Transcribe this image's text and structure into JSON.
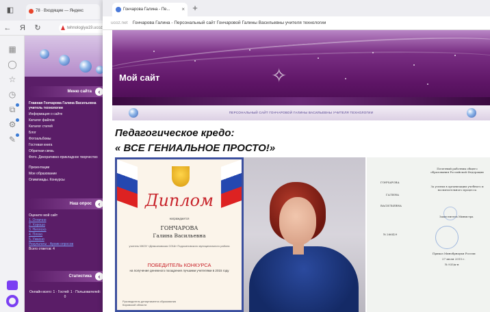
{
  "back_browser": {
    "tab1_label": "78 · Входящие — Яндекс",
    "url_text": "tehnologiya19.ucoz"
  },
  "front_browser": {
    "tab_label": "Гончарова Галина - Пе...",
    "address_prefix": "ucoz.net",
    "address_title": "Гончарова Галина - Персональный сайт Гончаровой Галины Васильевны учителя технологии"
  },
  "site": {
    "title": "Мой сайт",
    "subtitle": "ПЕРСОНАЛЬНЫЙ САЙТ ГОНЧАРОВОЙ ГАЛИНЫ ВАСИЛЬЕВНЫ УЧИТЕЛЯ ТЕХНОЛОГИИ",
    "creed_heading": "Педагогическое кредо:",
    "creed_text": "« ВСЕ ГЕНИАЛЬНОЕ ПРОСТО!»"
  },
  "menu": {
    "header": "Меню сайта",
    "items": [
      "Главная Гончарова Галина Васильевна учитель технологии",
      "Информация о сайте",
      "Каталог файлов",
      "Каталог статей",
      "Блог",
      "Фотоальбомы",
      "Гостевая книга",
      "Обратная связь",
      "Фото. Декоративно-прикладное творчество",
      "Презентации",
      "Мое образование",
      "Олимпиады. Конкурсы"
    ]
  },
  "login": {
    "header": "Наш опрос",
    "question": "Оцените мой сайт",
    "options": [
      "1. Отлично",
      "2. Хорошо",
      "3. Неплохо",
      "4. Плохо",
      "5. Ужасно"
    ],
    "links": "Результаты · Архив опросов",
    "total": "Всего ответов: 4"
  },
  "stats": {
    "header": "Статистика",
    "text": "Онлайн всего: 1 · Гостей: 1 · Пользователей: 0"
  },
  "diploma": {
    "word": "Диплом",
    "award_text": "награждается",
    "name_surname": "ГОНЧАРОВА",
    "name_given": "Галина Васильевна",
    "school": "учитель МКОУ «Демьяновская СОШ» Подосиновского муниципального района",
    "winner": "ПОБЕДИТЕЛЬ КОНКУРСА",
    "winner_sub": "на получение денежного поощрения лучшими учителями в 2015 году",
    "bottom": "Руководитель департамента образования Кировской области"
  },
  "certificate": {
    "lines": [
      "ГОНЧАРОВА",
      "ГАЛИНА",
      "ВАСИЛЬЕВНА",
      "№ 266429"
    ],
    "right_lines": [
      "Почетный работник общего образования Российской Федерации",
      "За успехи в организации учебного и воспитательного процесса",
      "Заместитель Министра",
      "Приказ Минобрнауки России",
      "27 июля 2015 г.",
      "№ 935/к-н"
    ]
  },
  "colors": {
    "menu_bg": "#5a1d67",
    "banner_mid": "#5e1566",
    "accent_red": "#c8242b"
  }
}
